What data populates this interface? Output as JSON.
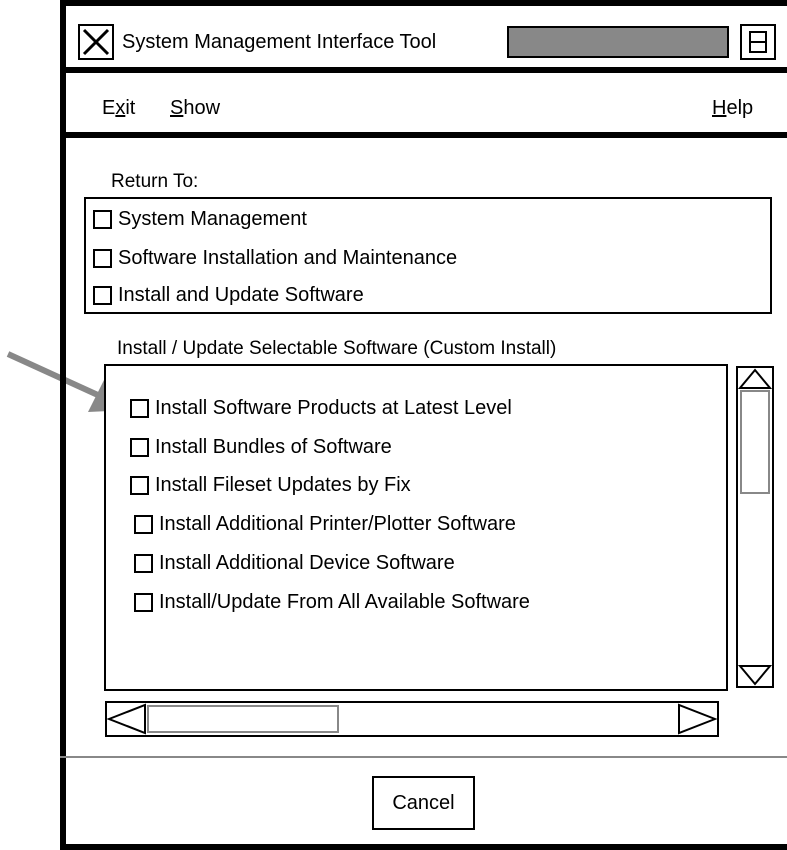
{
  "titlebar": {
    "title": "System Management Interface Tool",
    "close_icon": "x-close-icon",
    "maximize_icon": "maximize-icon"
  },
  "menu": {
    "exit": {
      "mnemonic_pre": "E",
      "mnemonic": "x",
      "rest": "it"
    },
    "show": {
      "mnemonic": "S",
      "rest": "how"
    },
    "help": {
      "mnemonic": "H",
      "rest": "elp"
    }
  },
  "return_to": {
    "label": "Return To:",
    "items": [
      "System Management",
      "Software Installation and Maintenance",
      "Install and Update Software"
    ]
  },
  "selectable": {
    "label": "Install / Update Selectable Software (Custom Install)",
    "items": [
      "Install Software Products at Latest Level",
      "Install Bundles of Software",
      "Install Fileset Updates by Fix",
      "Install Additional Printer/Plotter Software",
      "Install Additional Device Software",
      "Install/Update From All Available Software"
    ]
  },
  "footer": {
    "cancel_label": "Cancel"
  },
  "colors": {
    "border": "#000000",
    "field": "#888888",
    "arrow": "#888888",
    "background": "#ffffff"
  }
}
